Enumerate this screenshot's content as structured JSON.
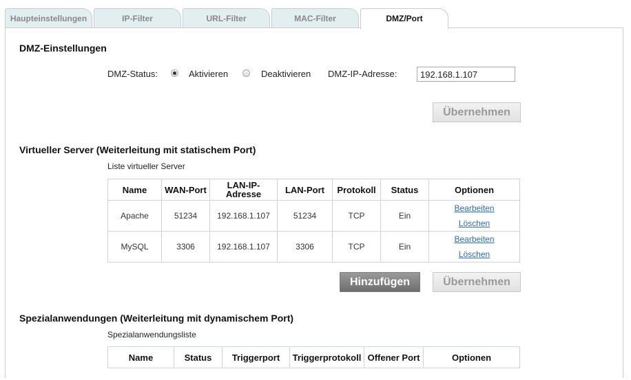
{
  "tabs": [
    "Haupteinstellungen",
    "IP-Filter",
    "URL-Filter",
    "MAC-Filter",
    "DMZ/Port"
  ],
  "dmz": {
    "title": "DMZ-Einstellungen",
    "status_label": "DMZ-Status:",
    "enable_label": "Aktivieren",
    "disable_label": "Deaktivieren",
    "selected": "Aktivieren",
    "ip_label": "DMZ-IP-Adresse:",
    "ip_value": "192.168.1.107",
    "apply_label": "Übernehmen"
  },
  "virtual_server": {
    "title": "Virtueller Server (Weiterleitung mit statischem Port)",
    "list_label": "Liste virtueller Server",
    "columns": [
      "Name",
      "WAN-Port",
      "LAN-IP-Adresse",
      "LAN-Port",
      "Protokoll",
      "Status",
      "Optionen"
    ],
    "rows": [
      [
        "Apache",
        "51234",
        "192.168.1.107",
        "51234",
        "TCP",
        "Ein"
      ],
      [
        "MySQL",
        "3306",
        "192.168.1.107",
        "3306",
        "TCP",
        "Ein"
      ]
    ],
    "edit_label": "Bearbeiten",
    "delete_label": "Löschen",
    "add_label": "Hinzufügen",
    "apply_label": "Übernehmen"
  },
  "special_apps": {
    "title": "Spezialanwendungen (Weiterleitung mit dynamischem Port)",
    "list_label": "Spezialanwendungsliste",
    "columns": [
      "Name",
      "Status",
      "Triggerport",
      "Triggerprotokoll",
      "Offener Port",
      "Optionen"
    ]
  }
}
